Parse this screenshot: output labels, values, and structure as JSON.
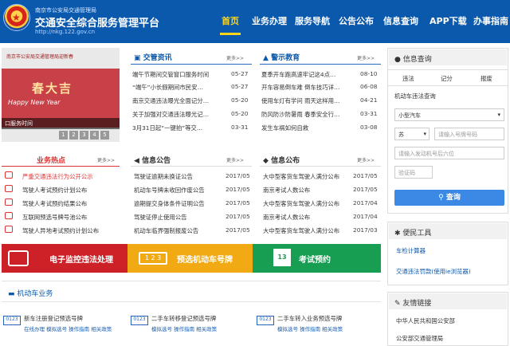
{
  "header": {
    "org": "南京市公安局交通管理局",
    "system_name": "交通安全综合服务管理平台",
    "url": "http://nkg.122.gov.cn",
    "logo_glyph": "★"
  },
  "nav": [
    "首页",
    "业务办理",
    "服务导航",
    "公告公布",
    "信息查询",
    "APP下载",
    "办事指南"
  ],
  "banner": {
    "caption": "口服务时间",
    "top_text": "南京市公安局交通管理局迎新春",
    "fu_text": "春大吉",
    "ny_text": "Happy New Year",
    "pages": [
      "1",
      "2",
      "3",
      "4",
      "5"
    ]
  },
  "news": {
    "title": "交管资讯",
    "more": "更多>>",
    "items": [
      {
        "t": "端午节期间交管窗口服务时间",
        "d": "05-27"
      },
      {
        "t": "“端午”小长假期间市民安…",
        "d": "05-27"
      },
      {
        "t": "南京交通违法曝光全面记分…",
        "d": "05-20"
      },
      {
        "t": "关于加强对交通违法曝光记…",
        "d": "05-20"
      },
      {
        "t": "3月31日起“一键拍”等交…",
        "d": "03-31"
      }
    ]
  },
  "warn": {
    "title": "警示教育",
    "more": "更多>>",
    "items": [
      {
        "t": "夏季开车跑高速牢记这4点…",
        "d": "08-10"
      },
      {
        "t": "开车容易倒车难 倒车技巧详…",
        "d": "06-08"
      },
      {
        "t": "使用车灯有学问 雨天这样用…",
        "d": "04-21"
      },
      {
        "t": "防风防沙防暑雨 春季安全行…",
        "d": "03-31"
      },
      {
        "t": "发生车祸如何自救",
        "d": "03-08"
      }
    ]
  },
  "hot": {
    "title": "业务热点",
    "more": "更多>>",
    "items": [
      "严重交通违法行为公开公示",
      "驾驶人考试预约计划公布",
      "驾驶人考试预约结果公布",
      "互联网预选号牌号池公布",
      "驾驶人异地考试预约计划公布"
    ]
  },
  "notice1": {
    "title": "信息公告",
    "more": "更多>>",
    "items": [
      {
        "t": "驾驶证逾期未换证公告",
        "d": "2017/05"
      },
      {
        "t": "机动车号牌未收回作废公告",
        "d": "2017/05"
      },
      {
        "t": "逾期提交身体条件证明公告",
        "d": "2017/05"
      },
      {
        "t": "驾驶证停止使用公告",
        "d": "2017/05"
      },
      {
        "t": "机动车临界强制报废公告",
        "d": "2017/05"
      }
    ]
  },
  "notice2": {
    "title": "信息公布",
    "more": "更多>>",
    "items": [
      {
        "t": "大中型客货车驾驶人满分公布",
        "d": "2017/05"
      },
      {
        "t": "南京考试人数公布",
        "d": "2017/05"
      },
      {
        "t": "大中型客货车驾驶人满分公布",
        "d": "2017/04"
      },
      {
        "t": "南京考试人数公布",
        "d": "2017/04"
      },
      {
        "t": "大中型客货车驾驶人满分公布",
        "d": "2017/03"
      }
    ]
  },
  "bars": [
    {
      "label": "电子监控违法处理",
      "color": "#cc2227"
    },
    {
      "label": "预选机动车号牌",
      "color": "#f1aa13"
    },
    {
      "label": "考试预约",
      "color": "#179e52"
    }
  ],
  "vehicle": {
    "title": "机动车业务",
    "items": [
      {
        "name": "新车注册登记预选号牌",
        "links": [
          "在线办理",
          "模拟选号",
          "操作指南",
          "相关政策"
        ]
      },
      {
        "name": "二手车转移登记预选号牌",
        "links": [
          "模拟选号",
          "操作指南",
          "相关政策"
        ]
      },
      {
        "name": "二手车转入业务预选号牌",
        "links": [
          "模拟选号",
          "操作指南",
          "相关政策"
        ]
      }
    ]
  },
  "query": {
    "title": "信息查询",
    "tabs": [
      "违法",
      "记分",
      "报废"
    ],
    "sub": "机动车违法查询",
    "car_type": "小型汽车",
    "prov": "苏",
    "plate_ph": "请输入号牌号码",
    "engine_ph": "请输入发动机号后六位",
    "code_ph": "验证码",
    "btn": "查询"
  },
  "tools": {
    "title": "便民工具",
    "items": [
      "车检计算器",
      "交通违法罚款(使用ie浏览器)"
    ]
  },
  "links": {
    "title": "友情链接",
    "items": [
      "中华人民共和国公安部",
      "公安部交通管理局"
    ]
  }
}
